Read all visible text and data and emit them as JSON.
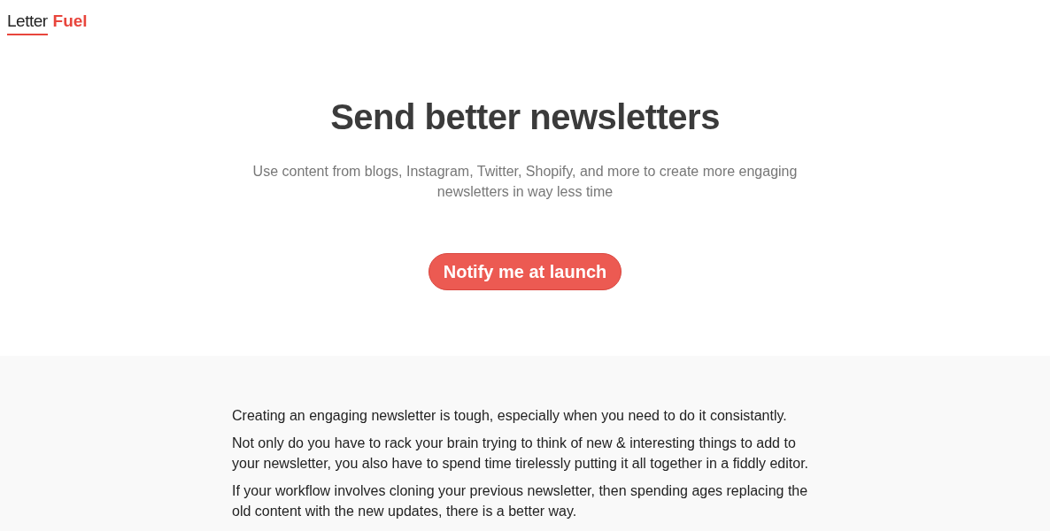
{
  "logo": {
    "first_word": "Letter",
    "second_word": "Fuel"
  },
  "hero": {
    "title": "Send better newsletters",
    "subtitle": "Use content from blogs, Instagram, Twitter, Shopify, and more to create more engaging newsletters in way less time",
    "cta_button": "Notify me at launch"
  },
  "intro": {
    "paragraphs": [
      "Creating an engaging newsletter is tough, especially when you need to do it consistantly.",
      "Not only do you have to rack your brain trying to think of new & interesting things to add to your newsletter, you also have to spend time tirelessly putting it all together in a fiddly editor.",
      "If your workflow involves cloning your previous newsletter, then spending ages replacing the old content with the new updates, there is a better way."
    ]
  }
}
